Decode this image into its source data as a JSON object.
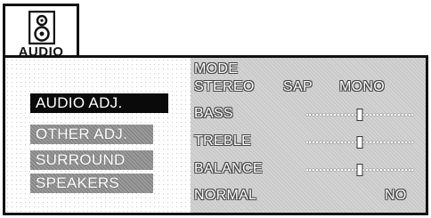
{
  "header": {
    "label": "AUDIO",
    "icon": "speaker-icon"
  },
  "menu": {
    "items": [
      {
        "label": "AUDIO ADJ.",
        "selected": true
      },
      {
        "label": "OTHER ADJ.",
        "selected": false
      },
      {
        "label": "SURROUND",
        "selected": false
      },
      {
        "label": "SPEAKERS",
        "selected": false
      }
    ]
  },
  "settings": {
    "mode": {
      "label": "MODE",
      "options": [
        "STEREO",
        "SAP",
        "MONO"
      ]
    },
    "bass": {
      "label": "BASS",
      "level": 0.5
    },
    "treble": {
      "label": "TREBLE",
      "level": 0.5
    },
    "balance": {
      "label": "BALANCE",
      "level": 0.5
    },
    "normal": {
      "label": "NORMAL",
      "value": "NO"
    }
  }
}
